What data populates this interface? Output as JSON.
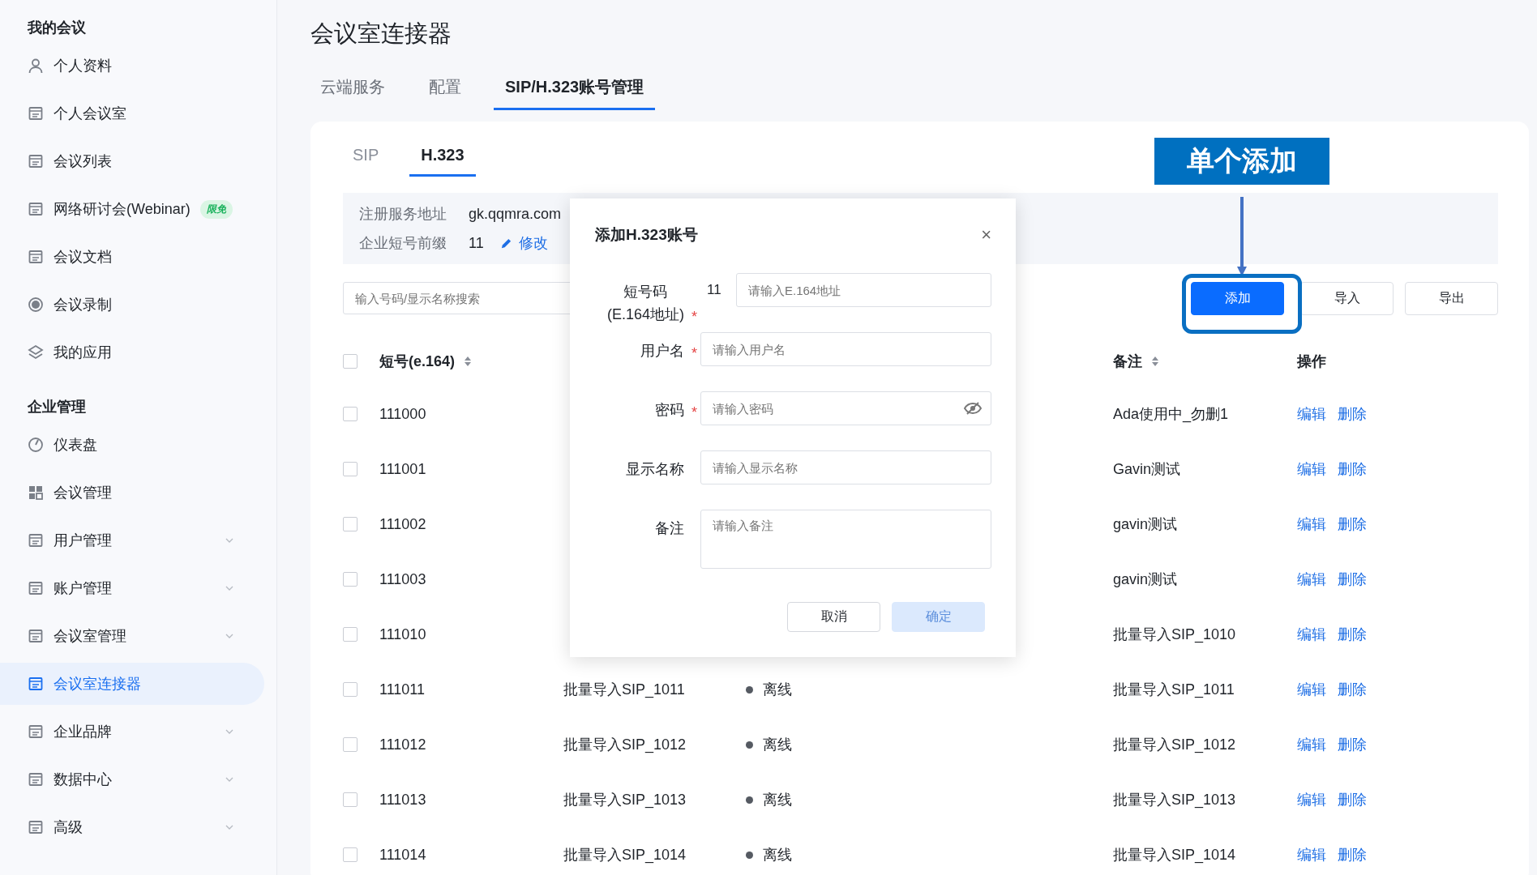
{
  "sidebar": {
    "groups": [
      {
        "title": "我的会议",
        "items": [
          {
            "label": "个人资料",
            "selected": false
          },
          {
            "label": "个人会议室",
            "selected": false
          },
          {
            "label": "会议列表",
            "selected": false
          },
          {
            "label": "网络研讨会(Webinar)",
            "badge": "限免",
            "selected": false
          },
          {
            "label": "会议文档",
            "selected": false
          },
          {
            "label": "会议录制",
            "selected": false
          },
          {
            "label": "我的应用",
            "selected": false
          }
        ]
      },
      {
        "title": "企业管理",
        "items": [
          {
            "label": "仪表盘",
            "selected": false
          },
          {
            "label": "会议管理",
            "selected": false
          },
          {
            "label": "用户管理",
            "expandable": true,
            "selected": false
          },
          {
            "label": "账户管理",
            "expandable": true,
            "selected": false
          },
          {
            "label": "会议室管理",
            "expandable": true,
            "selected": false
          },
          {
            "label": "会议室连接器",
            "selected": true
          },
          {
            "label": "企业品牌",
            "expandable": true,
            "selected": false
          },
          {
            "label": "数据中心",
            "expandable": true,
            "selected": false
          },
          {
            "label": "高级",
            "expandable": true,
            "selected": false
          }
        ]
      }
    ]
  },
  "page_title": "会议室连接器",
  "tabs": [
    {
      "label": "云端服务",
      "selected": false
    },
    {
      "label": "配置",
      "selected": false
    },
    {
      "label": "SIP/H.323账号管理",
      "selected": true
    }
  ],
  "subtabs": [
    {
      "label": "SIP",
      "selected": false
    },
    {
      "label": "H.323",
      "selected": true
    }
  ],
  "info": [
    {
      "label": "注册服务地址",
      "value": "gk.qqmra.com"
    },
    {
      "label": "企业短号前缀",
      "value": "11",
      "action": "修改"
    }
  ],
  "search": {
    "placeholder": "输入号码/显示名称搜索"
  },
  "buttons": [
    {
      "label": "添加",
      "primary": true
    },
    {
      "label": "导入",
      "primary": false
    },
    {
      "label": "导出",
      "primary": false
    }
  ],
  "table": {
    "all_checked": false,
    "columns": [
      {
        "label": "短号(e.164)",
        "sortable": true
      },
      {
        "label": "备注",
        "sortable": true
      },
      {
        "label": "操作",
        "sortable": false
      }
    ],
    "rows": [
      {
        "number": "111000",
        "note": "Ada使用中_勿删1",
        "actions": [
          "编辑",
          "删除"
        ],
        "checked": false
      },
      {
        "number": "111001",
        "note": "Gavin测试",
        "actions": [
          "编辑",
          "删除"
        ],
        "checked": false
      },
      {
        "number": "111002",
        "note": "gavin测试",
        "actions": [
          "编辑",
          "删除"
        ],
        "checked": false
      },
      {
        "number": "111003",
        "note": "gavin测试",
        "actions": [
          "编辑",
          "删除"
        ],
        "checked": false
      },
      {
        "number": "111010",
        "note": "批量导入SIP_1010",
        "actions": [
          "编辑",
          "删除"
        ],
        "checked": false
      },
      {
        "number": "111011",
        "name": "批量导入SIP_1011",
        "status": "离线",
        "note": "批量导入SIP_1011",
        "actions": [
          "编辑",
          "删除"
        ],
        "checked": false
      },
      {
        "number": "111012",
        "name": "批量导入SIP_1012",
        "status": "离线",
        "note": "批量导入SIP_1012",
        "actions": [
          "编辑",
          "删除"
        ],
        "checked": false
      },
      {
        "number": "111013",
        "name": "批量导入SIP_1013",
        "status": "离线",
        "note": "批量导入SIP_1013",
        "actions": [
          "编辑",
          "删除"
        ],
        "checked": false
      },
      {
        "number": "111014",
        "name": "批量导入SIP_1014",
        "status": "离线",
        "note": "批量导入SIP_1014",
        "actions": [
          "编辑",
          "删除"
        ],
        "checked": false
      }
    ]
  },
  "dialog": {
    "title": "添加H.323账号",
    "close": "×",
    "required_mark": "*",
    "fields": [
      {
        "kind": "input",
        "label": "短号码",
        "label_line2": "(E.164地址)",
        "required": true,
        "prefix": "11",
        "placeholder": "请输入E.164地址"
      },
      {
        "kind": "input",
        "label": "用户名",
        "required": true,
        "placeholder": "请输入用户名"
      },
      {
        "kind": "password",
        "label": "密码",
        "required": true,
        "placeholder": "请输入密码"
      },
      {
        "kind": "input",
        "label": "显示名称",
        "required": false,
        "placeholder": "请输入显示名称"
      },
      {
        "kind": "textarea",
        "label": "备注",
        "required": false,
        "placeholder": "请输入备注"
      }
    ],
    "buttons": [
      {
        "label": "取消",
        "primary": false,
        "disabled": false
      },
      {
        "label": "确定",
        "primary": true,
        "disabled": true
      }
    ]
  },
  "annotation": {
    "label": "单个添加"
  }
}
